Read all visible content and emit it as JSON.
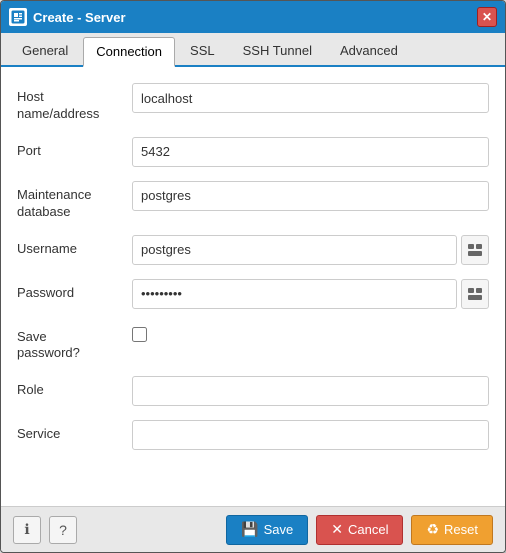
{
  "window": {
    "title": "Create - Server",
    "close_label": "✕"
  },
  "tabs": [
    {
      "id": "general",
      "label": "General",
      "active": false
    },
    {
      "id": "connection",
      "label": "Connection",
      "active": true
    },
    {
      "id": "ssl",
      "label": "SSL",
      "active": false
    },
    {
      "id": "ssh_tunnel",
      "label": "SSH Tunnel",
      "active": false
    },
    {
      "id": "advanced",
      "label": "Advanced",
      "active": false
    }
  ],
  "form": {
    "fields": [
      {
        "id": "host",
        "label": "Host\nname/address",
        "type": "text",
        "value": "localhost",
        "has_icon": false
      },
      {
        "id": "port",
        "label": "Port",
        "type": "text",
        "value": "5432",
        "has_icon": false
      },
      {
        "id": "maintenance_db",
        "label": "Maintenance\ndatabase",
        "type": "text",
        "value": "postgres",
        "has_icon": false
      },
      {
        "id": "username",
        "label": "Username",
        "type": "text",
        "value": "postgres",
        "has_icon": true
      },
      {
        "id": "password",
        "label": "Password",
        "type": "password",
        "value": "•••••••••",
        "has_icon": true
      }
    ],
    "save_password": {
      "label": "Save\npassword?",
      "checked": false
    },
    "role": {
      "label": "Role",
      "value": ""
    },
    "service": {
      "label": "Service",
      "value": ""
    }
  },
  "footer": {
    "info_icon": "ℹ",
    "help_icon": "?",
    "save_label": "Save",
    "cancel_label": "Cancel",
    "reset_label": "Reset"
  }
}
